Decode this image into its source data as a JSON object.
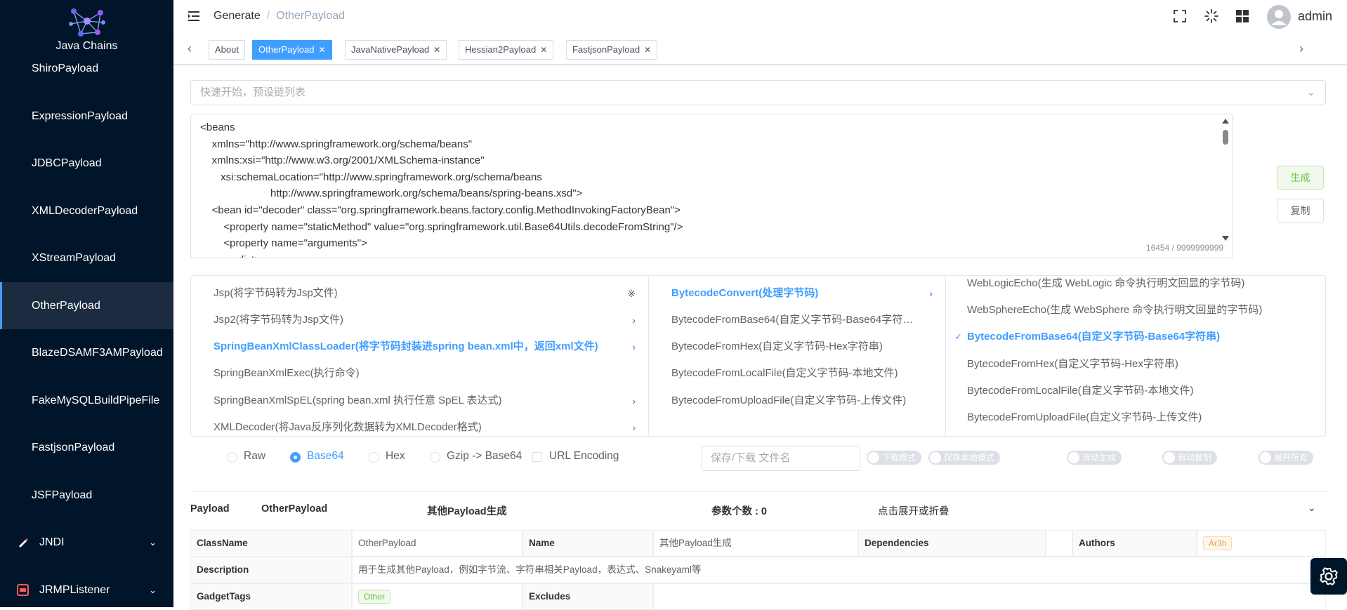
{
  "app": {
    "logo_text": "Java Chains"
  },
  "sidebar": {
    "items": [
      {
        "label": "ShiroPayload"
      },
      {
        "label": "ExpressionPayload"
      },
      {
        "label": "JDBCPayload"
      },
      {
        "label": "XMLDecoderPayload"
      },
      {
        "label": "XStreamPayload"
      },
      {
        "label": "OtherPayload"
      },
      {
        "label": "BlazeDSAMF3AMPayload"
      },
      {
        "label": "FakeMySQLBuildPipeFile"
      },
      {
        "label": "FastjsonPayload"
      },
      {
        "label": "JSFPayload"
      },
      {
        "label": "JNDI"
      },
      {
        "label": "JRMPListener"
      }
    ],
    "active": "OtherPayload"
  },
  "header": {
    "breadcrumb": [
      "Generate",
      "OtherPayload"
    ],
    "user": "admin"
  },
  "tags": [
    {
      "label": "About"
    },
    {
      "label": "OtherPayload"
    },
    {
      "label": "JavaNativePayload"
    },
    {
      "label": "Hessian2Payload"
    },
    {
      "label": "FastjsonPayload"
    }
  ],
  "quick_start": {
    "placeholder": "快速开始，预设链列表"
  },
  "editor": {
    "content": "<beans\n    xmlns=\"http://www.springframework.org/schema/beans\"\n    xmlns:xsi=\"http://www.w3.org/2001/XMLSchema-instance\"\n       xsi:schemaLocation=\"http://www.springframework.org/schema/beans\n                        http://www.springframework.org/schema/beans/spring-beans.xsd\">\n    <bean id=\"decoder\" class=\"org.springframework.beans.factory.config.MethodInvokingFactoryBean\">\n        <property name=\"staticMethod\" value=\"org.springframework.util.Base64Utils.decodeFromString\"/>\n        <property name=\"arguments\">\n            <list>",
    "count": "16454 / 9999999999"
  },
  "actions": {
    "generate": "生成",
    "copy": "复制"
  },
  "cascader": {
    "col1": [
      {
        "label": "Jsp(将字节码转为Jsp文件)",
        "state": "loading"
      },
      {
        "label": "Jsp2(将字节码转为Jsp文件)",
        "state": "expand"
      },
      {
        "label": "SpringBeanXmlClassLoader(将字节码封装进spring bean.xml中，返回xml文件)",
        "state": "active"
      },
      {
        "label": "SpringBeanXmlExec(执行命令)",
        "state": "leaf"
      },
      {
        "label": "SpringBeanXmlSpEL(spring bean.xml 执行任意 SpEL 表达式)",
        "state": "expand"
      },
      {
        "label": "XMLDecoder(将Java反序列化数据转为XMLDecoder格式)",
        "state": "expand"
      }
    ],
    "col2": [
      {
        "label": "BytecodeConvert(处理字节码)",
        "state": "active"
      },
      {
        "label": "BytecodeFromBase64(自定义字节码-Base64字符串)",
        "state": "leaf"
      },
      {
        "label": "BytecodeFromHex(自定义字节码-Hex字符串)",
        "state": "leaf"
      },
      {
        "label": "BytecodeFromLocalFile(自定义字节码-本地文件)",
        "state": "leaf"
      },
      {
        "label": "BytecodeFromUploadFile(自定义字节码-上传文件)",
        "state": "leaf"
      }
    ],
    "col3": [
      {
        "label": "WebLogicEcho(生成 WebLogic 命令执行明文回显的字节码)",
        "state": "leaf"
      },
      {
        "label": "WebSphereEcho(生成 WebSphere 命令执行明文回显的字节码)",
        "state": "leaf"
      },
      {
        "label": "BytecodeFromBase64(自定义字节码-Base64字符串)",
        "state": "checked"
      },
      {
        "label": "BytecodeFromHex(自定义字节码-Hex字符串)",
        "state": "leaf"
      },
      {
        "label": "BytecodeFromLocalFile(自定义字节码-本地文件)",
        "state": "leaf"
      },
      {
        "label": "BytecodeFromUploadFile(自定义字节码-上传文件)",
        "state": "leaf"
      }
    ]
  },
  "options": {
    "encodings": [
      "Raw",
      "Base64",
      "Hex",
      "Gzip -> Base64"
    ],
    "selected": "Base64",
    "url_encoding": "URL Encoding",
    "filename_placeholder": "保存/下载 文件名",
    "switches": [
      "下载模式",
      "保存本地模式",
      "自动生成",
      "自动复制",
      "展开所有"
    ]
  },
  "payload_panel": {
    "label": "Payload",
    "name": "OtherPayload",
    "title": "其他Payload生成",
    "params": "参数个数 : 0",
    "toggle_hint": "点击展开或折叠"
  },
  "details": {
    "classname_label": "ClassName",
    "classname": "OtherPayload",
    "name_label": "Name",
    "name": "其他Payload生成",
    "dependencies_label": "Dependencies",
    "dependencies": "",
    "authors_label": "Authors",
    "author": "Ar3h",
    "description_label": "Description",
    "description": "用于生成其他Payload，例如字节流、字符串相关Payload，表达式、Snakeyaml等",
    "gadgettags_label": "GadgetTags",
    "gadgettag": "Other",
    "excludes_label": "Excludes"
  },
  "colors": {
    "primary": "#409eff",
    "sidebar_bg": "#001529",
    "success": "#67c23a",
    "warning": "#e6a23c"
  }
}
